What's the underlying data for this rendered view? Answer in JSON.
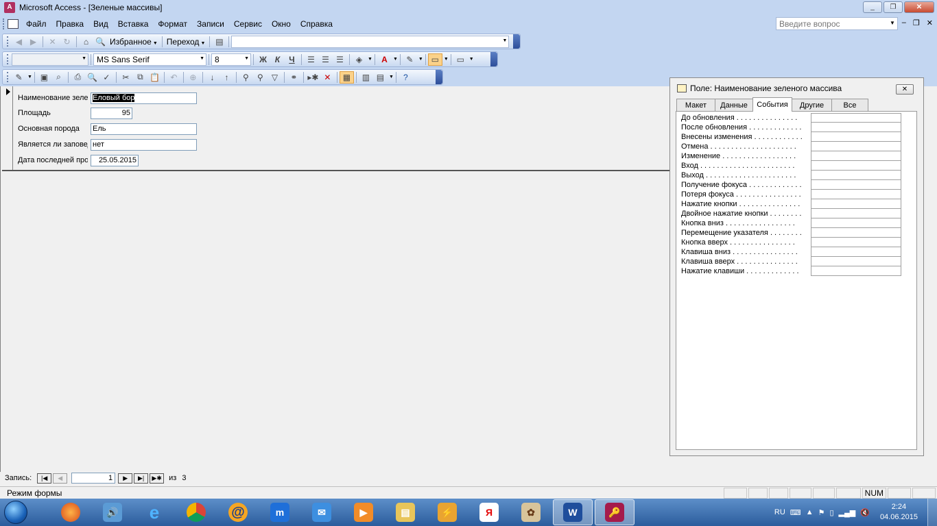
{
  "window": {
    "title": "Microsoft Access - [Зеленые массивы]",
    "app_icon": "access-icon",
    "minimize_icon": "_",
    "restore_icon": "❐",
    "close_icon": "✕"
  },
  "menubar": {
    "items": [
      "Файл",
      "Правка",
      "Вид",
      "Вставка",
      "Формат",
      "Записи",
      "Сервис",
      "Окно",
      "Справка"
    ],
    "ask_placeholder": "Введите вопрос",
    "doc_minimize": "–",
    "doc_restore": "❐",
    "doc_close": "✕"
  },
  "toolbar_web": {
    "favorites_label": "Избранное",
    "go_label": "Переход"
  },
  "toolbar_format": {
    "font_name": "MS Sans Serif",
    "font_size": "8",
    "bold": "Ж",
    "italic": "К",
    "underline": "Ч"
  },
  "form": {
    "fields": [
      {
        "label": "Наименование зеленого массива",
        "value": "Еловый бор"
      },
      {
        "label": "Площадь",
        "value": "95"
      },
      {
        "label": "Основная порода",
        "value": "Ель"
      },
      {
        "label": "Является ли заповедником",
        "value": "нет"
      },
      {
        "label": "Дата последней проверки",
        "value": "25.05.2015"
      }
    ]
  },
  "navigation": {
    "label": "Запись:",
    "current": "1",
    "of_label": "из",
    "total": "3"
  },
  "statusbar": {
    "text": "Режим формы",
    "num": "NUM"
  },
  "properties": {
    "title": "Поле: Наименование зеленого массива",
    "tabs": [
      "Макет",
      "Данные",
      "События",
      "Другие",
      "Все"
    ],
    "active_tab": "События",
    "rows": [
      "До обновления . . . . . . . . . . . . . . .",
      "После обновления . . . . . . . . . . . . .",
      "Внесены изменения . . . . . . . . . . . .",
      "Отмена . . . . . . . . . . . . . . . . . . . . .",
      "Изменение . . . . . . . . . . . . . . . . . .",
      "Вход . . . . . . . . . . . . . . . . . . . . . . .",
      "Выход . . . . . . . . . . . . . . . . . . . . . .",
      "Получение фокуса . . . . . . . . . . . . .",
      "Потеря фокуса . . . . . . . . . . . . . . . .",
      "Нажатие кнопки . . . . . . . . . . . . . . .",
      "Двойное нажатие кнопки . . . . . . . .",
      "Кнопка вниз . . . . . . . . . . . . . . . . .",
      "Перемещение указателя . . . . . . . .",
      "Кнопка вверх . . . . . . . . . . . . . . . .",
      "Клавиша вниз . . . . . . . . . . . . . . . .",
      "Клавиша вверх . . . . . . . . . . . . . . .",
      "Нажатие клавиши . . . . . . . . . . . . ."
    ]
  },
  "taskbar": {
    "apps": [
      "firefox-icon",
      "volume-app-icon",
      "ie-icon",
      "chrome-icon",
      "mail-ru-agent-icon",
      "maxthon-icon",
      "mail-icon",
      "media-player-icon",
      "explorer-folder-icon",
      "winamp-icon",
      "yandex-icon",
      "mahjong-icon",
      "word-icon",
      "access-icon"
    ],
    "word_glyph": "W",
    "yandex_glyph": "Я",
    "maxthon_glyph": "m",
    "lang": "RU",
    "time": "2:24",
    "date": "04.06.2015"
  },
  "colors": {
    "titlebar": "#c3d6f1",
    "selection": "#000000",
    "taskbar": "#2b5c9c"
  }
}
